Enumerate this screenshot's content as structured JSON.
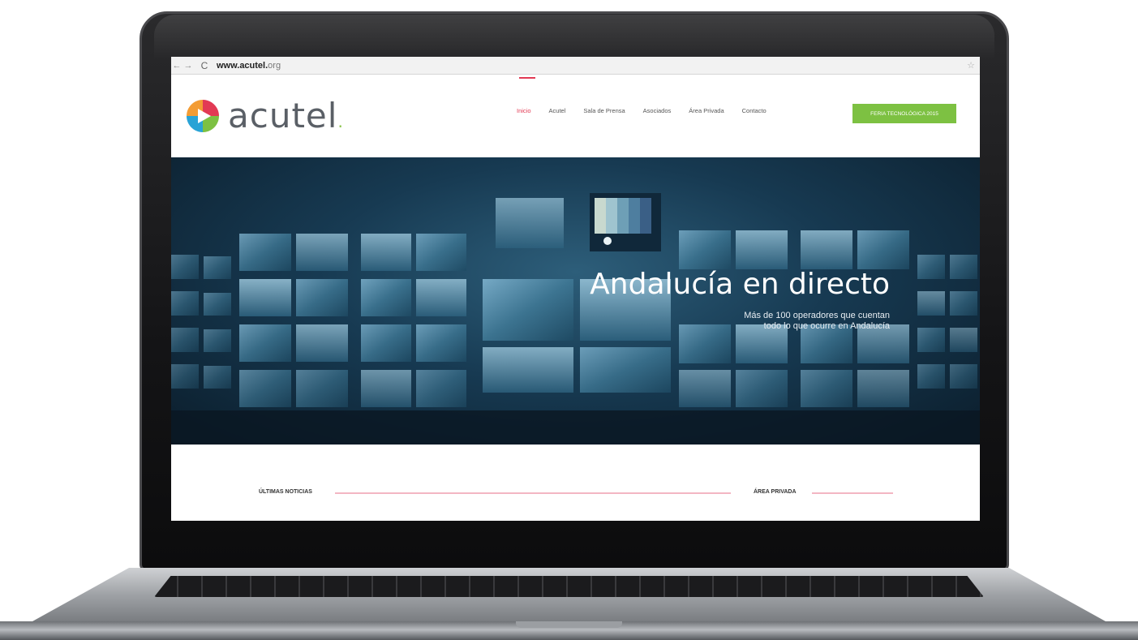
{
  "browser": {
    "url_domain": "www.acutel.",
    "url_tld": "org",
    "back_icon": "arrow-left-icon",
    "forward_icon": "arrow-right-icon",
    "reload_icon": "reload-icon"
  },
  "site": {
    "logo_text": "acutel",
    "logo_dot": ".",
    "nav": [
      {
        "label": "Inicio",
        "active": true
      },
      {
        "label": "Acutel",
        "active": false
      },
      {
        "label": "Sala de Prensa",
        "active": false
      },
      {
        "label": "Asociados",
        "active": false
      },
      {
        "label": "Área Privada",
        "active": false
      },
      {
        "label": "Contacto",
        "active": false
      }
    ],
    "cta_label": "FERIA TECNOLÓGICA 2015"
  },
  "hero": {
    "title": "Andalucía en directo",
    "subtitle_line1": "Más de 100 operadores que cuentan",
    "subtitle_line2": "todo lo que ocurre en Andalucía"
  },
  "sections": {
    "news_label": "ÚLTIMAS NOTICIAS",
    "private_label": "ÁREA PRIVADA"
  },
  "colors": {
    "accent": "#e23a54",
    "cta": "#7dc142",
    "rule": "#f3b6c3"
  }
}
